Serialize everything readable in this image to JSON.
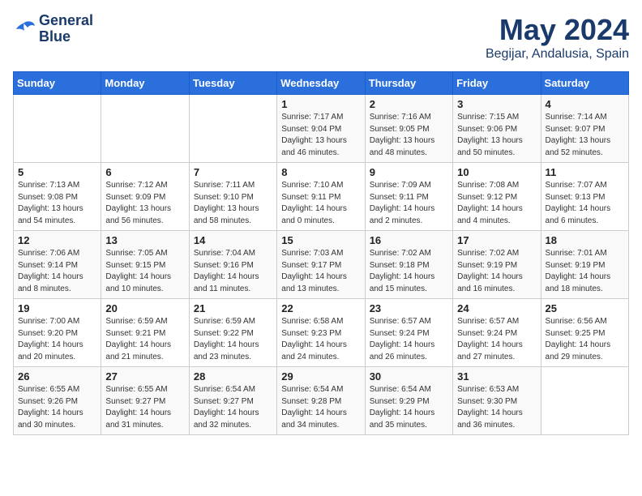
{
  "header": {
    "logo_line1": "General",
    "logo_line2": "Blue",
    "title": "May 2024",
    "subtitle": "Begijar, Andalusia, Spain"
  },
  "days_of_week": [
    "Sunday",
    "Monday",
    "Tuesday",
    "Wednesday",
    "Thursday",
    "Friday",
    "Saturday"
  ],
  "weeks": [
    [
      {
        "day": "",
        "detail": ""
      },
      {
        "day": "",
        "detail": ""
      },
      {
        "day": "",
        "detail": ""
      },
      {
        "day": "1",
        "detail": "Sunrise: 7:17 AM\nSunset: 9:04 PM\nDaylight: 13 hours\nand 46 minutes."
      },
      {
        "day": "2",
        "detail": "Sunrise: 7:16 AM\nSunset: 9:05 PM\nDaylight: 13 hours\nand 48 minutes."
      },
      {
        "day": "3",
        "detail": "Sunrise: 7:15 AM\nSunset: 9:06 PM\nDaylight: 13 hours\nand 50 minutes."
      },
      {
        "day": "4",
        "detail": "Sunrise: 7:14 AM\nSunset: 9:07 PM\nDaylight: 13 hours\nand 52 minutes."
      }
    ],
    [
      {
        "day": "5",
        "detail": "Sunrise: 7:13 AM\nSunset: 9:08 PM\nDaylight: 13 hours\nand 54 minutes."
      },
      {
        "day": "6",
        "detail": "Sunrise: 7:12 AM\nSunset: 9:09 PM\nDaylight: 13 hours\nand 56 minutes."
      },
      {
        "day": "7",
        "detail": "Sunrise: 7:11 AM\nSunset: 9:10 PM\nDaylight: 13 hours\nand 58 minutes."
      },
      {
        "day": "8",
        "detail": "Sunrise: 7:10 AM\nSunset: 9:11 PM\nDaylight: 14 hours\nand 0 minutes."
      },
      {
        "day": "9",
        "detail": "Sunrise: 7:09 AM\nSunset: 9:11 PM\nDaylight: 14 hours\nand 2 minutes."
      },
      {
        "day": "10",
        "detail": "Sunrise: 7:08 AM\nSunset: 9:12 PM\nDaylight: 14 hours\nand 4 minutes."
      },
      {
        "day": "11",
        "detail": "Sunrise: 7:07 AM\nSunset: 9:13 PM\nDaylight: 14 hours\nand 6 minutes."
      }
    ],
    [
      {
        "day": "12",
        "detail": "Sunrise: 7:06 AM\nSunset: 9:14 PM\nDaylight: 14 hours\nand 8 minutes."
      },
      {
        "day": "13",
        "detail": "Sunrise: 7:05 AM\nSunset: 9:15 PM\nDaylight: 14 hours\nand 10 minutes."
      },
      {
        "day": "14",
        "detail": "Sunrise: 7:04 AM\nSunset: 9:16 PM\nDaylight: 14 hours\nand 11 minutes."
      },
      {
        "day": "15",
        "detail": "Sunrise: 7:03 AM\nSunset: 9:17 PM\nDaylight: 14 hours\nand 13 minutes."
      },
      {
        "day": "16",
        "detail": "Sunrise: 7:02 AM\nSunset: 9:18 PM\nDaylight: 14 hours\nand 15 minutes."
      },
      {
        "day": "17",
        "detail": "Sunrise: 7:02 AM\nSunset: 9:19 PM\nDaylight: 14 hours\nand 16 minutes."
      },
      {
        "day": "18",
        "detail": "Sunrise: 7:01 AM\nSunset: 9:19 PM\nDaylight: 14 hours\nand 18 minutes."
      }
    ],
    [
      {
        "day": "19",
        "detail": "Sunrise: 7:00 AM\nSunset: 9:20 PM\nDaylight: 14 hours\nand 20 minutes."
      },
      {
        "day": "20",
        "detail": "Sunrise: 6:59 AM\nSunset: 9:21 PM\nDaylight: 14 hours\nand 21 minutes."
      },
      {
        "day": "21",
        "detail": "Sunrise: 6:59 AM\nSunset: 9:22 PM\nDaylight: 14 hours\nand 23 minutes."
      },
      {
        "day": "22",
        "detail": "Sunrise: 6:58 AM\nSunset: 9:23 PM\nDaylight: 14 hours\nand 24 minutes."
      },
      {
        "day": "23",
        "detail": "Sunrise: 6:57 AM\nSunset: 9:24 PM\nDaylight: 14 hours\nand 26 minutes."
      },
      {
        "day": "24",
        "detail": "Sunrise: 6:57 AM\nSunset: 9:24 PM\nDaylight: 14 hours\nand 27 minutes."
      },
      {
        "day": "25",
        "detail": "Sunrise: 6:56 AM\nSunset: 9:25 PM\nDaylight: 14 hours\nand 29 minutes."
      }
    ],
    [
      {
        "day": "26",
        "detail": "Sunrise: 6:55 AM\nSunset: 9:26 PM\nDaylight: 14 hours\nand 30 minutes."
      },
      {
        "day": "27",
        "detail": "Sunrise: 6:55 AM\nSunset: 9:27 PM\nDaylight: 14 hours\nand 31 minutes."
      },
      {
        "day": "28",
        "detail": "Sunrise: 6:54 AM\nSunset: 9:27 PM\nDaylight: 14 hours\nand 32 minutes."
      },
      {
        "day": "29",
        "detail": "Sunrise: 6:54 AM\nSunset: 9:28 PM\nDaylight: 14 hours\nand 34 minutes."
      },
      {
        "day": "30",
        "detail": "Sunrise: 6:54 AM\nSunset: 9:29 PM\nDaylight: 14 hours\nand 35 minutes."
      },
      {
        "day": "31",
        "detail": "Sunrise: 6:53 AM\nSunset: 9:30 PM\nDaylight: 14 hours\nand 36 minutes."
      },
      {
        "day": "",
        "detail": ""
      }
    ]
  ]
}
